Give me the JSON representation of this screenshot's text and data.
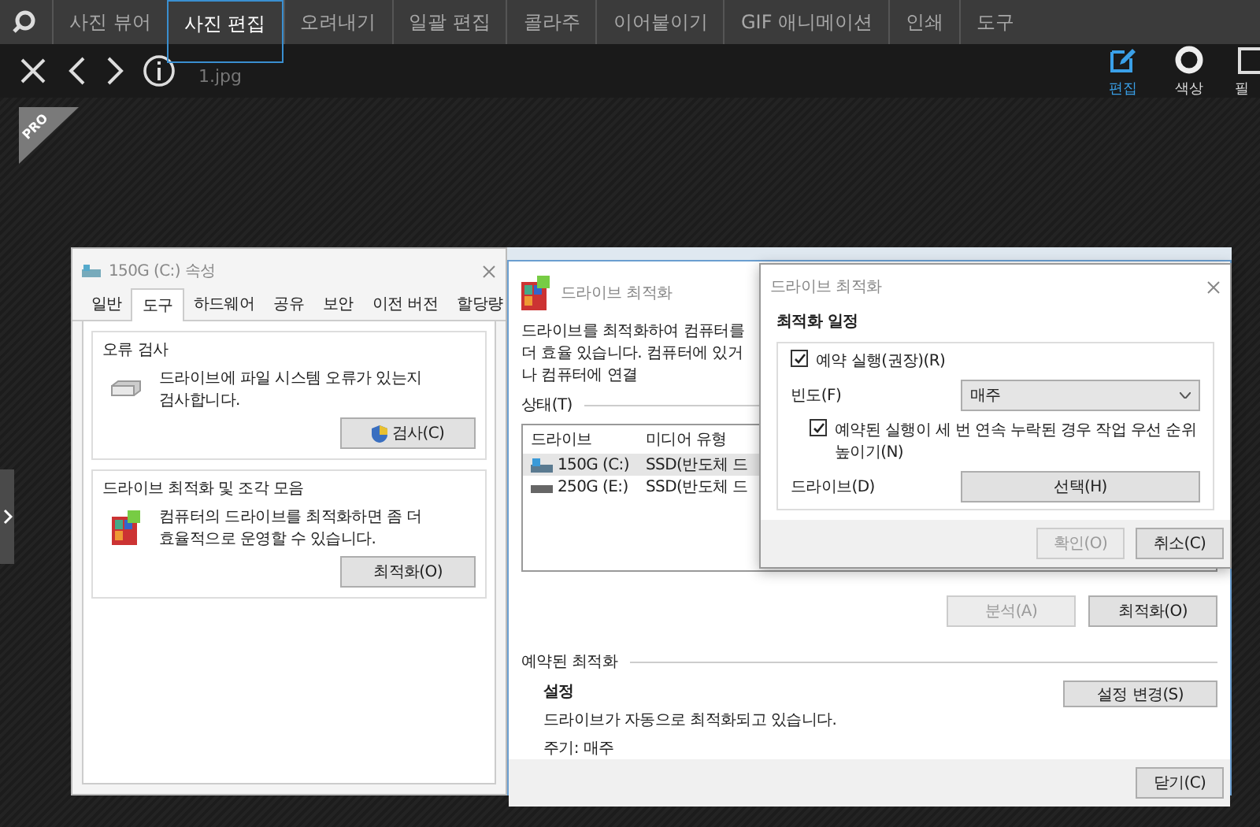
{
  "app_tabs": [
    {
      "label": "사진 뷰어",
      "selected": false
    },
    {
      "label": "사진 편집",
      "selected": true
    },
    {
      "label": "오려내기",
      "selected": false
    },
    {
      "label": "일괄 편집",
      "selected": false
    },
    {
      "label": "콜라주",
      "selected": false
    },
    {
      "label": "이어붙이기",
      "selected": false
    },
    {
      "label": "GIF 애니메이션",
      "selected": false
    },
    {
      "label": "인쇄",
      "selected": false
    },
    {
      "label": "도구",
      "selected": false
    }
  ],
  "toolbar": {
    "filename": "1.jpg",
    "tools": [
      {
        "kind": "edit",
        "label": "편집",
        "selected": true
      },
      {
        "kind": "color",
        "label": "색상",
        "selected": false
      },
      {
        "kind": "frame",
        "label": "필",
        "selected": false
      }
    ]
  },
  "badge": {
    "label": "PRO"
  },
  "screenshot": {
    "properties_window": {
      "title": "150G (C:) 속성",
      "tabs": [
        {
          "label": "일반",
          "selected": false
        },
        {
          "label": "도구",
          "selected": true
        },
        {
          "label": "하드웨어",
          "selected": false
        },
        {
          "label": "공유",
          "selected": false
        },
        {
          "label": "보안",
          "selected": false
        },
        {
          "label": "이전 버전",
          "selected": false
        },
        {
          "label": "할당량",
          "selected": false
        }
      ],
      "groups": [
        {
          "kind": "check",
          "title": "오류 검사",
          "text": "드라이브에 파일 시스템 오류가 있는지 검사합니다.",
          "button": "검사(C)"
        },
        {
          "kind": "defrag",
          "title": "드라이브 최적화 및 조각 모음",
          "text": "컴퓨터의 드라이브를 최적화하면 좀 더 효율적으로 운영할 수 있습니다.",
          "button": "최적화(O)"
        }
      ]
    },
    "optimize_window": {
      "title": "드라이브 최적화",
      "description": "드라이브를 최적화하여 컴퓨터를 더 효율 있습니다. 컴퓨터에 있거나 컴퓨터에 연결",
      "status_label": "상태(T)",
      "columns": [
        "드라이브",
        "미디어 유형"
      ],
      "rows": [
        {
          "kind": "system",
          "drive": "150G (C:)",
          "media": "SSD(반도체 드",
          "selected": true
        },
        {
          "kind": "plain",
          "drive": "250G (E:)",
          "media": "SSD(반도체 드",
          "selected": false
        }
      ],
      "buttons": [
        {
          "label": "분석(A)",
          "disabled": true
        },
        {
          "label": "최적화(O)",
          "disabled": false
        }
      ],
      "scheduled": {
        "label": "예약된 최적화",
        "heading": "설정",
        "status": "드라이브가 자동으로 최적화되고 있습니다.",
        "period": "주기: 매주",
        "button": "설정 변경(S)"
      },
      "close_button": "닫기(C)"
    },
    "schedule_dialog": {
      "title": "드라이브 최적화",
      "heading": "최적화 일정",
      "run_scheduled": {
        "label": "예약 실행(권장)(R)",
        "checked": true
      },
      "frequency_label": "빈도(F)",
      "frequency": "매주",
      "priority": {
        "label": "예약된 실행이 세 번 연속 누락된 경우 작업 우선 순위 높이기(N)",
        "checked": true
      },
      "drives_label": "드라이브(D)",
      "drives_button": "선택(H)",
      "buttons": [
        {
          "label": "확인(O)",
          "disabled": true
        },
        {
          "label": "취소(C)",
          "disabled": false
        }
      ]
    }
  }
}
